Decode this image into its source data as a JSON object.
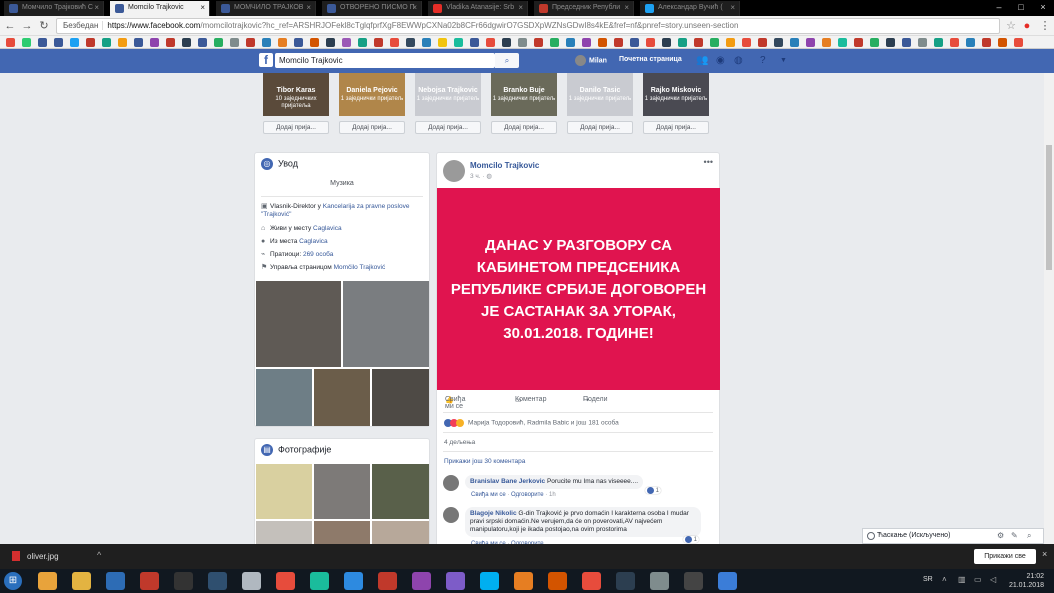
{
  "browser": {
    "tabs": [
      {
        "title": "Момчило Трајковић С",
        "color": "#3b5998"
      },
      {
        "title": "Momcilo Trajkovic",
        "color": "#3b5998"
      },
      {
        "title": "МОМЧИЛО ТРАЈКОВ",
        "color": "#3b5998"
      },
      {
        "title": "ОТВОРЕНО ПИСМО П",
        "color": "#3b5998"
      },
      {
        "title": "Vladika Atanasije: Srb",
        "color": "#e52d27"
      },
      {
        "title": "Председник Републи",
        "color": "#c0392b"
      },
      {
        "title": "Александар Вучић (",
        "color": "#1da1f2"
      }
    ],
    "secure_label": "Безбедан",
    "url_host": "https://www.facebook.com",
    "url_rest": "/momcilotrajkovic?hc_ref=ARSHRJOFekl8cTglqfprfXgF8EWWpCXNa02b8CFr66dgwirO7GSDXpWZNsGDwI8s4kE&fref=nf&pnref=story.unseen-section"
  },
  "facebook": {
    "search_value": "Momcilo Trajkovic",
    "user_name": "Milan",
    "home_label": "Почетна страница"
  },
  "friends": [
    {
      "name": "Tibor Karas",
      "mutual": "10 заједничких пријатеља",
      "bg": "#5a4a3a"
    },
    {
      "name": "Daniela Pejovic",
      "mutual": "1 заједнички пријатељ",
      "bg": "#b0864a"
    },
    {
      "name": "Nebojsa Trajkovic",
      "mutual": "1 заједнички пријатељ",
      "bg": "#c9cbd1"
    },
    {
      "name": "Branko Buje",
      "mutual": "1 заједнички пријатељ",
      "bg": "#6a6a5a"
    },
    {
      "name": "Danilo Tasic",
      "mutual": "1 заједнички пријатељ",
      "bg": "#c9cbd1"
    },
    {
      "name": "Rajko Miskovic",
      "mutual": "1 заједнички пријатељ",
      "bg": "#4a4a52"
    }
  ],
  "add_friend_label": "Додај прија...",
  "intro": {
    "title": "Увод",
    "music": "Музика",
    "work_prefix": "Vlasnik-Direktor у ",
    "work_place": "Kancelarija za pravne poslove \"Trajković\"",
    "lives_prefix": "Живи у месту ",
    "lives_place": "Caglavica",
    "from_prefix": "Из места ",
    "from_place": "Caglavica",
    "followers_prefix": "Пратиоци: ",
    "followers_count": "269 особа",
    "manages_prefix": "Управља страницом ",
    "manages_page": "Momčilo Trajković"
  },
  "photos_title": "Фотографије",
  "post": {
    "author": "Momcilo Trajkovic",
    "time": "3 ч.",
    "banner_text": "ДАНАС У РАЗГОВОРУ СА КАБИНЕТОМ ПРЕДСЕНИКА РЕПУБЛИКЕ СРБИЈЕ ДОГОВОРЕН ЈЕ САСТАНАК ЗА УТОРАК, 30.01.2018. ГОДИНЕ!",
    "banner_color": "#e0144f",
    "like_label": "Свиђа ми се",
    "comment_label": "Коментар",
    "share_label": "Подели",
    "reactions_text": "Марија Тодоровић, Radmila Babic и још 181 особа",
    "shares_text": "4 дељења",
    "more_comments": "Прикажи још 30 коментара"
  },
  "comments": [
    {
      "author": "Branislav Bane Jerkovic",
      "text": "Porucite mu Ima nas viseeee....",
      "like": "Свиђа ми се",
      "reply": "Одговорите",
      "time": "1h",
      "count": "1"
    },
    {
      "author": "Blagoje Nikolic",
      "text": "G-din Trajković je prvo domaćin I karakterna osoba I mudar pravi srpski domaćin.Ne verujem,da će on poverovati,AV najvećem manipulatoru,koji je ikada postojao,na ovim prostorima",
      "like": "Свиђа ми се",
      "reply": "Одговорите",
      "time": "",
      "count": "1"
    }
  ],
  "chat": {
    "label": "Ћаскање (Искључено)"
  },
  "download": {
    "file": "oliver.jpg",
    "show_all": "Прикажи све"
  },
  "taskbar": {
    "lang": "SR",
    "time": "21:02",
    "date": "21.01.2018"
  }
}
